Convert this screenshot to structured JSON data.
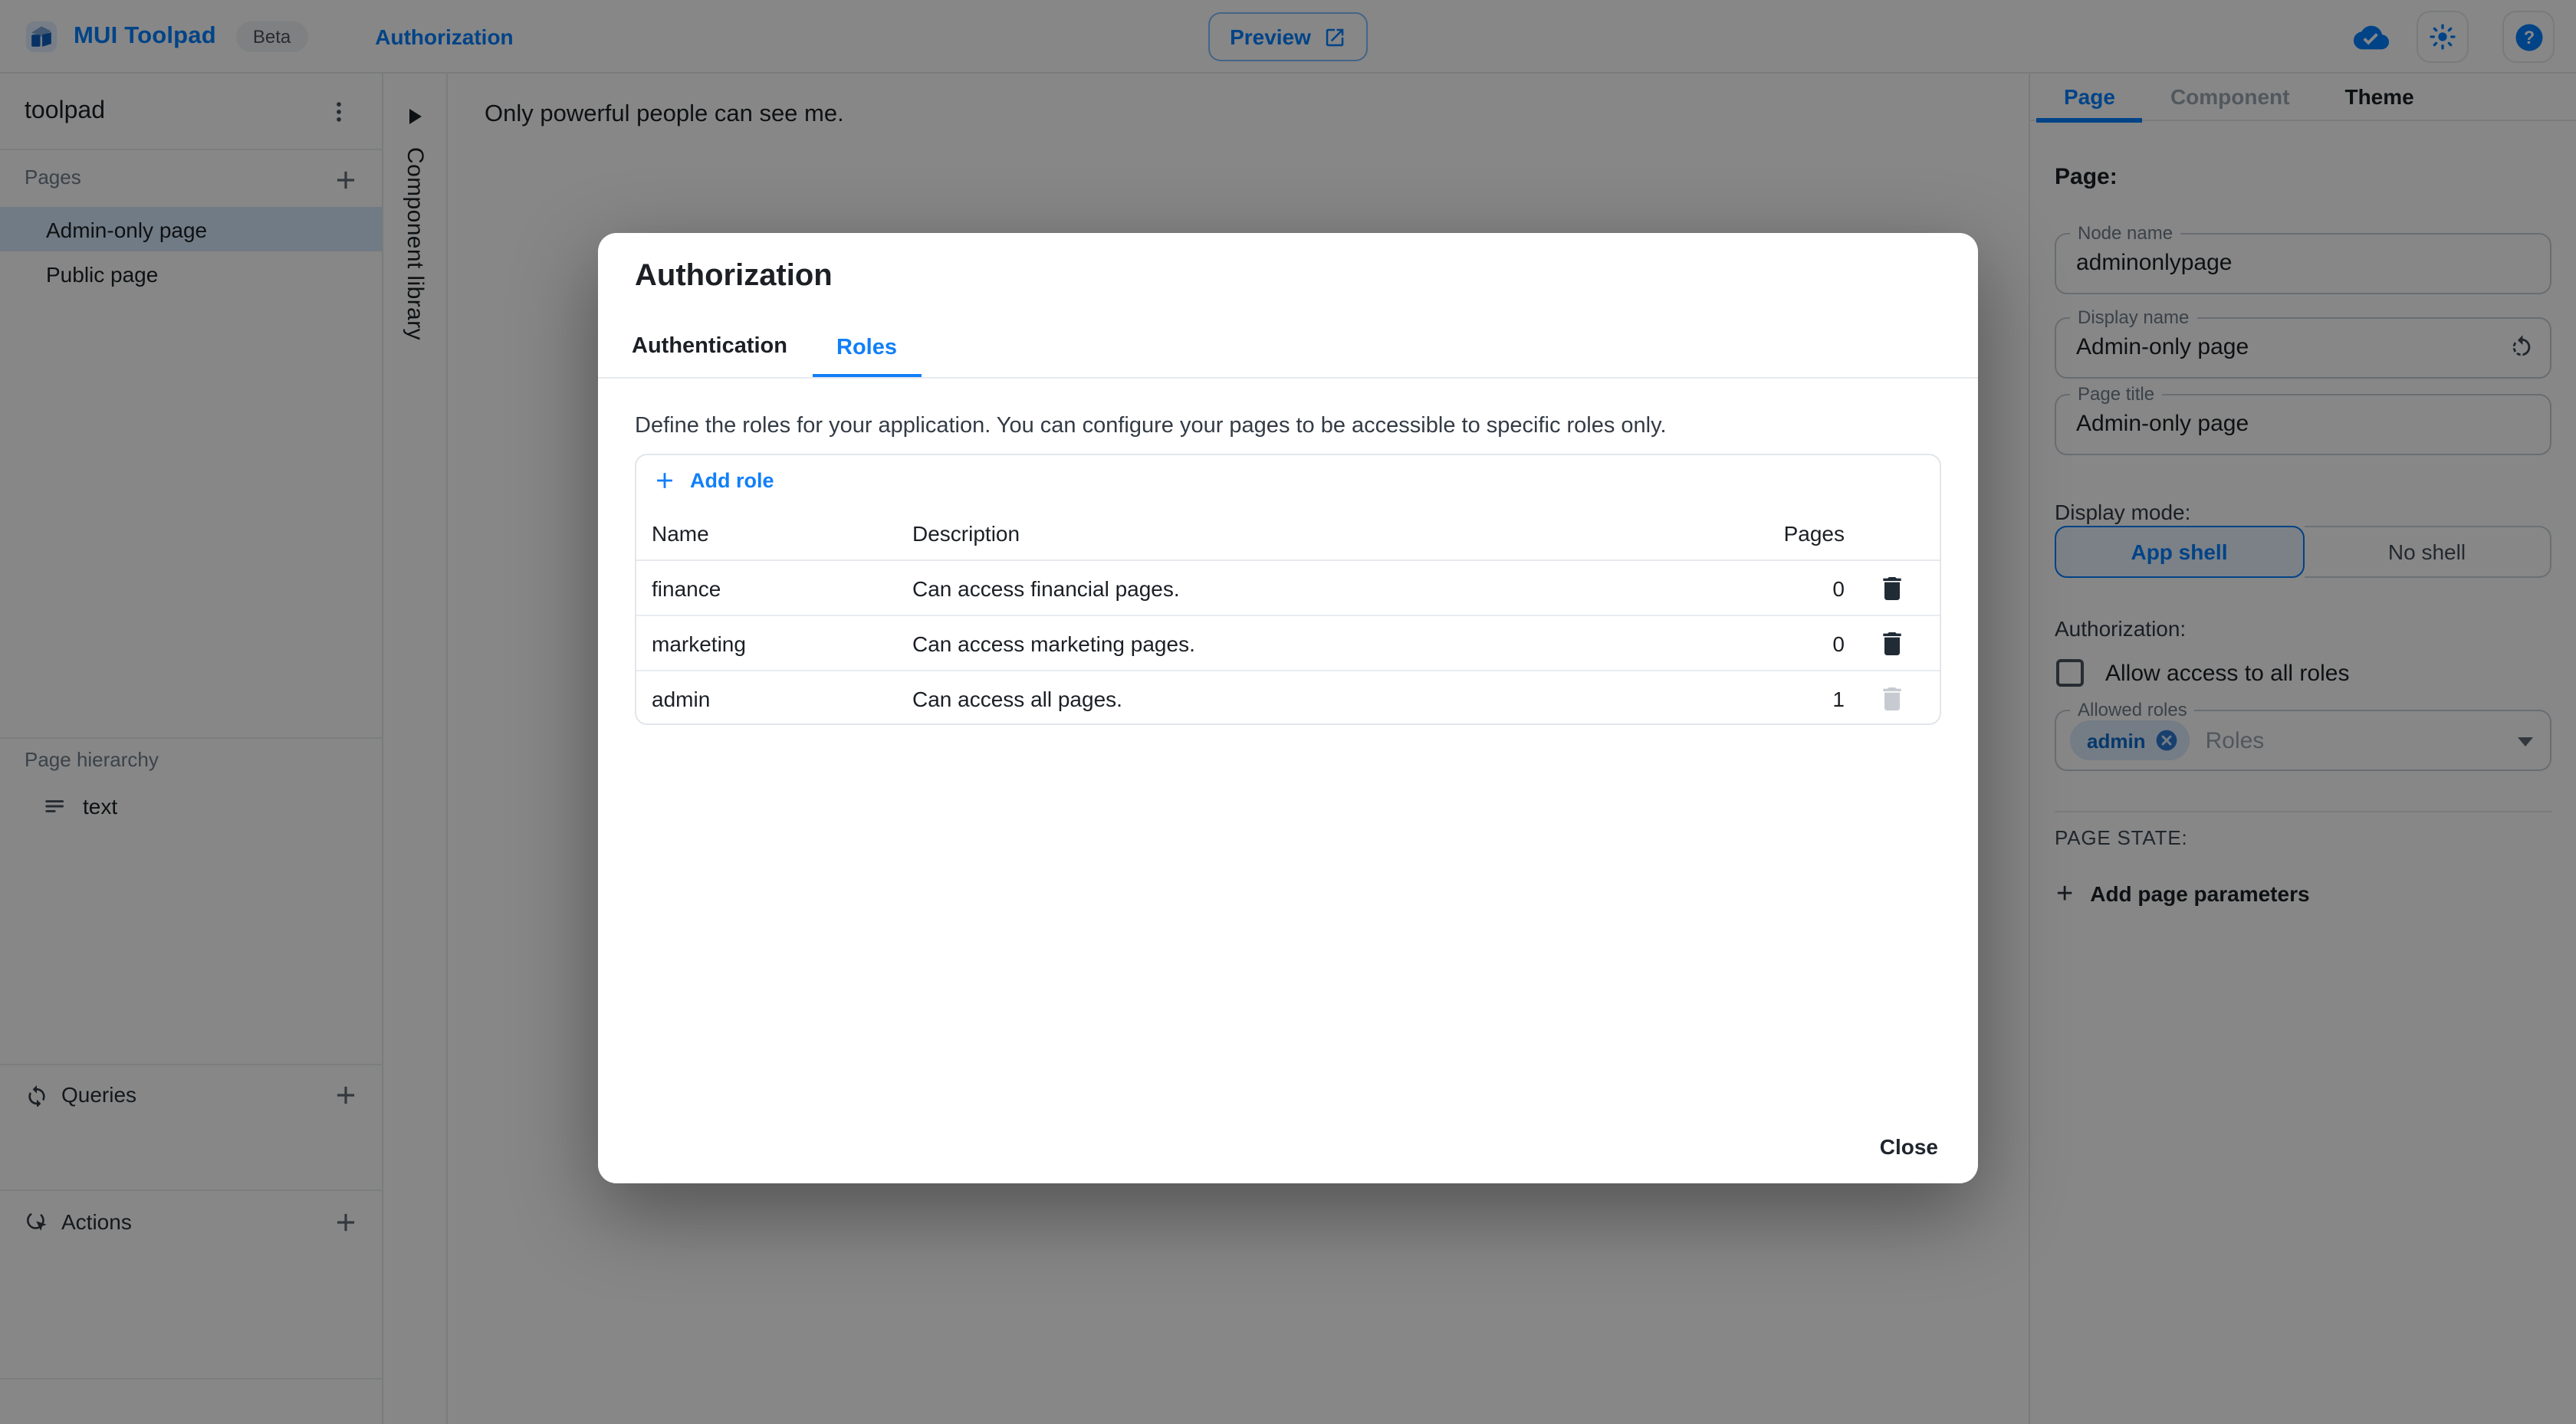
{
  "header": {
    "brand": "MUI Toolpad",
    "beta_badge": "Beta",
    "breadcrumb": "Authorization",
    "preview_button": "Preview"
  },
  "sidebar": {
    "app_name": "toolpad",
    "pages_header": "Pages",
    "pages": [
      {
        "label": "Admin-only page",
        "selected": true
      },
      {
        "label": "Public page",
        "selected": false
      }
    ],
    "hierarchy_header": "Page hierarchy",
    "hierarchy_items": [
      {
        "label": "text"
      }
    ],
    "queries_header": "Queries",
    "actions_header": "Actions"
  },
  "component_library": {
    "label": "Component library"
  },
  "canvas": {
    "text": "Only powerful people can see me."
  },
  "dialog": {
    "title": "Authorization",
    "tabs": [
      {
        "label": "Authentication"
      },
      {
        "label": "Roles"
      }
    ],
    "active_tab": "Roles",
    "description": "Define the roles for your application. You can configure your pages to be accessible to specific roles only.",
    "add_role_button": "Add role",
    "table": {
      "columns": [
        "Name",
        "Description",
        "Pages"
      ],
      "rows": [
        {
          "name": "finance",
          "description": "Can access financial pages.",
          "pages": "0",
          "delete_disabled": false
        },
        {
          "name": "marketing",
          "description": "Can access marketing pages.",
          "pages": "0",
          "delete_disabled": false
        },
        {
          "name": "admin",
          "description": "Can access all pages.",
          "pages": "1",
          "delete_disabled": true
        }
      ]
    },
    "close_button": "Close"
  },
  "inspector": {
    "tabs": [
      {
        "label": "Page"
      },
      {
        "label": "Component"
      },
      {
        "label": "Theme"
      }
    ],
    "active_tab": "Page",
    "heading": "Page:",
    "fields": [
      {
        "label": "Node name",
        "value": "adminonlypage"
      },
      {
        "label": "Display name",
        "value": "Admin-only page"
      },
      {
        "label": "Page title",
        "value": "Admin-only page"
      }
    ],
    "display_mode": {
      "label": "Display mode:",
      "options": [
        {
          "label": "App shell",
          "selected": true
        },
        {
          "label": "No shell",
          "selected": false
        }
      ]
    },
    "authorization": {
      "label": "Authorization:",
      "checkbox_label": "Allow access to all roles",
      "checked": false,
      "allowed_roles": {
        "label": "Allowed roles",
        "chips": [
          "admin"
        ],
        "placeholder": "Roles"
      }
    },
    "page_state": {
      "label": "PAGE STATE:",
      "add_button": "Add page parameters"
    }
  },
  "colors": {
    "primary": "#007FFF",
    "text": "#1C2025",
    "muted": "#6F7E8C",
    "border": "#E5E8EC",
    "backdrop": "rgba(0,0,0,0.47)"
  }
}
